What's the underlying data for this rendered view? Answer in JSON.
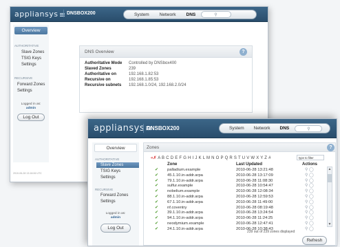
{
  "logo": "appliansys",
  "back_window": {
    "device": "DNSBOX200",
    "nav": [
      "System",
      "Network",
      "DNS"
    ],
    "sidebar": {
      "overview": "Overview",
      "authoritative_label": "Authoritative",
      "authoritative_items": [
        "Slave Zones",
        "TSIG Keys",
        "Settings"
      ],
      "recursive_label": "Recursive",
      "recursive_items": [
        "Forward Zones",
        "Settings"
      ],
      "logged_in_as": "Logged in as:",
      "username": "admin",
      "logout": "Log Out",
      "footer_date": "2010-06-28 13:18:06 UTC"
    },
    "dns_overview": {
      "title": "DNS Overview",
      "rows": [
        {
          "label": "Authoritative Mode",
          "value": "Controlled by DNSbox400"
        },
        {
          "label": "Slaved Zones",
          "value": "239"
        },
        {
          "label": "Authoritative on",
          "value": "192.168.1.82:53"
        },
        {
          "label": "Recursive on",
          "value": "192.168.1.85:53"
        },
        {
          "label": "Recursive subnets",
          "value": "192.168.1.0/24, 192.168.2.0/24"
        }
      ]
    }
  },
  "front_window": {
    "device": "DNSBOX200",
    "nav": [
      "System",
      "Network",
      "DNS"
    ],
    "sidebar": {
      "overview": "Overview",
      "authoritative_label": "Authoritative",
      "authoritative_items": [
        "Slave Zones",
        "TSIG Keys",
        "Settings"
      ],
      "recursive_label": "Recursive",
      "recursive_items": [
        "Forward Zones",
        "Settings"
      ],
      "logged_in_as": "Logged in as:",
      "username": "admin",
      "logout": "Log Out"
    },
    "zones": {
      "title": "Zones",
      "alphabet": "A B C D E F G H I J K L M N O P Q R S T U V W X Y Z #",
      "filter_placeholder": "type to filter",
      "columns": {
        "zone": "Zone",
        "last_updated": "Last Updated",
        "actions": "Actions"
      },
      "rows": [
        {
          "zone": "palladium.example",
          "updated": "2010-06-28 13:21:48"
        },
        {
          "zone": "45.1.10.in-addr.arpa",
          "updated": "2010-06-28 13:17:09"
        },
        {
          "zone": "79.1.10.in-addr.arpa",
          "updated": "2010-06-28 11:08:30"
        },
        {
          "zone": "sulfur.example",
          "updated": "2010-06-28 10:54:47"
        },
        {
          "zone": "nobelium.example",
          "updated": "2010-06-28 12:08:34"
        },
        {
          "zone": "88.1.10.in-addr.arpa",
          "updated": "2010-06-28 12:59:53"
        },
        {
          "zone": "67.1.10.in-addr.arpa",
          "updated": "2010-06-28 11:49:00"
        },
        {
          "zone": "nf.coventry",
          "updated": "2010-06-28 08:19:48"
        },
        {
          "zone": "39.1.10.in-addr.arpa",
          "updated": "2010-06-28 13:24:54"
        },
        {
          "zone": "94.1.10.in-addr.arpa",
          "updated": "2010-06-28 11:24:25"
        },
        {
          "zone": "neodymium.example",
          "updated": "2010-06-28 12:47:41"
        },
        {
          "zone": "24.1.10.in-addr.arpa",
          "updated": "2010-06-28 10:38:43"
        }
      ],
      "count_text": "239 out of 239 zones displayed",
      "refresh": "Refresh"
    }
  }
}
